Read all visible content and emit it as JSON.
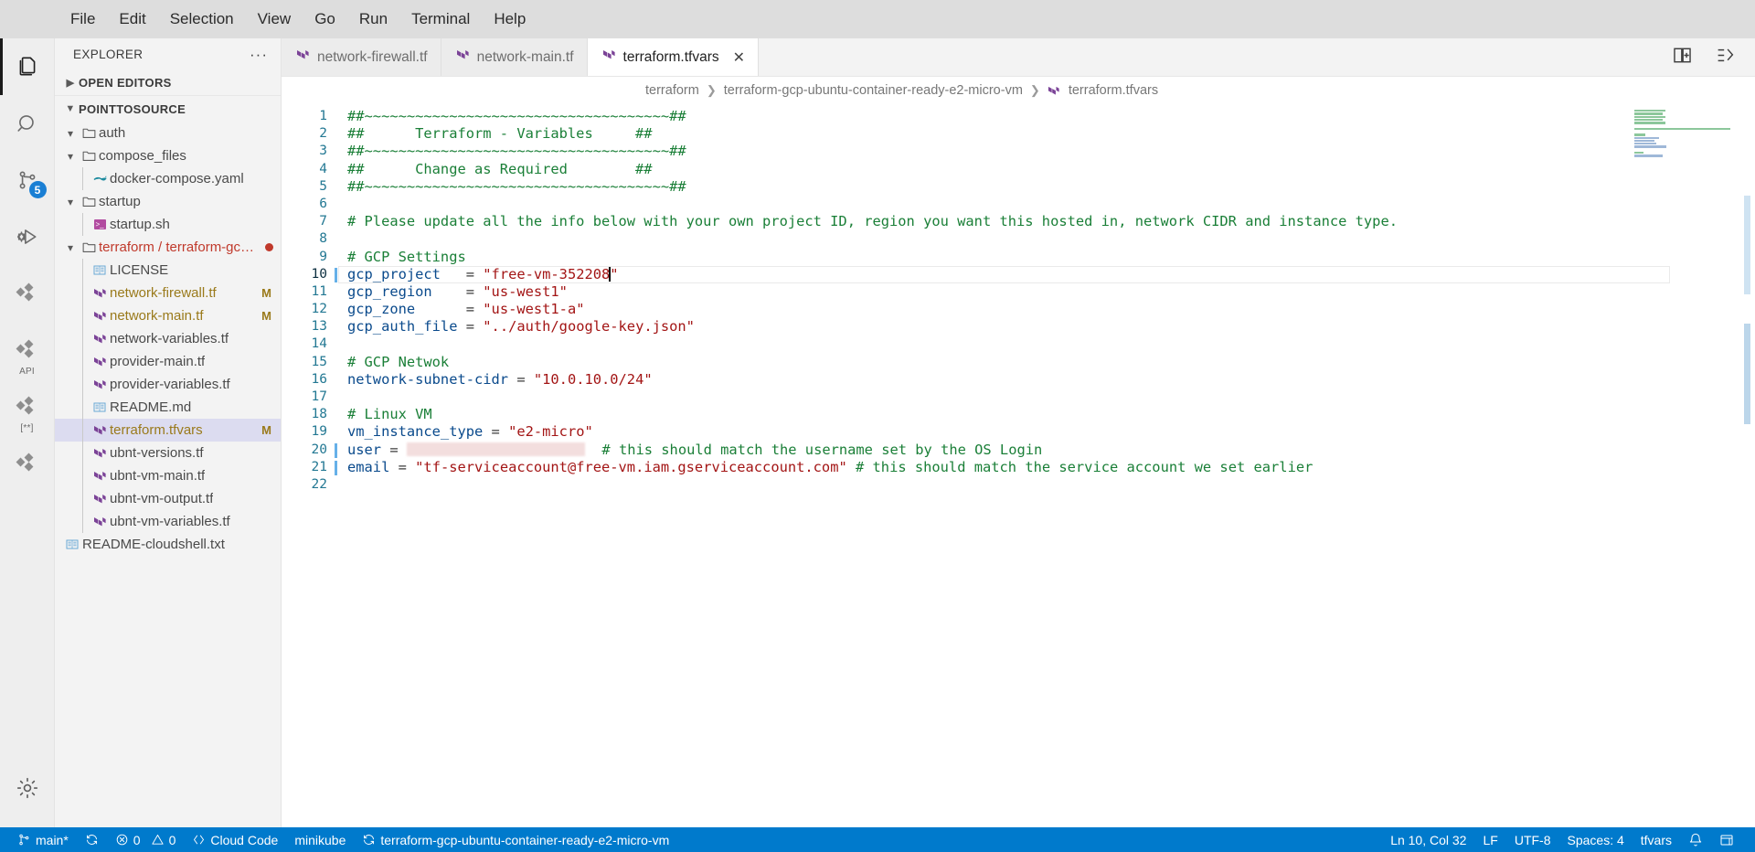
{
  "menubar": {
    "items": [
      "File",
      "Edit",
      "Selection",
      "View",
      "Go",
      "Run",
      "Terminal",
      "Help"
    ]
  },
  "activitybar": {
    "items": [
      {
        "name": "explorer-icon",
        "glyph": "files",
        "active": true,
        "badge": null,
        "sub": null
      },
      {
        "name": "search-icon",
        "glyph": "search",
        "active": false,
        "badge": null,
        "sub": null
      },
      {
        "name": "source-control-icon",
        "glyph": "source-control",
        "active": false,
        "badge": "5",
        "sub": null
      },
      {
        "name": "run-and-debug-icon",
        "glyph": "debug",
        "active": false,
        "badge": null,
        "sub": null
      },
      {
        "name": "extensions-icon",
        "glyph": "extensions",
        "active": false,
        "badge": null,
        "sub": null
      },
      {
        "name": "api-extension-icon",
        "glyph": "extensions",
        "active": false,
        "badge": null,
        "sub": "API"
      },
      {
        "name": "secrets-extension-icon",
        "glyph": "extensions",
        "active": false,
        "badge": null,
        "sub": "[**]"
      },
      {
        "name": "kubernetes-extension-icon",
        "glyph": "extensions",
        "active": false,
        "badge": null,
        "sub": null
      }
    ],
    "settings_label": "manage-gear"
  },
  "sidebar": {
    "title": "EXPLORER",
    "more_actions": "···",
    "open_editors_label": "OPEN EDITORS",
    "workspace_label": "POINTTOSOURCE",
    "tree": [
      {
        "label": "auth",
        "kind": "folder",
        "depth": 1,
        "expanded": true,
        "color": "plain",
        "modified": "",
        "selected": false,
        "dirty": false
      },
      {
        "label": "compose_files",
        "kind": "folder",
        "depth": 1,
        "expanded": true,
        "color": "plain",
        "modified": "",
        "selected": false,
        "dirty": false
      },
      {
        "label": "docker-compose.yaml",
        "kind": "yaml",
        "depth": 2,
        "expanded": null,
        "color": "plain",
        "modified": "",
        "selected": false,
        "dirty": false
      },
      {
        "label": "startup",
        "kind": "folder",
        "depth": 1,
        "expanded": true,
        "color": "plain",
        "modified": "",
        "selected": false,
        "dirty": false
      },
      {
        "label": "startup.sh",
        "kind": "shell",
        "depth": 2,
        "expanded": null,
        "color": "plain",
        "modified": "",
        "selected": false,
        "dirty": false
      },
      {
        "label": "terraform / terraform-gcp-ubuntu",
        "kind": "folder",
        "depth": 1,
        "expanded": true,
        "color": "red",
        "modified": "",
        "selected": false,
        "dirty": true
      },
      {
        "label": "LICENSE",
        "kind": "doc",
        "depth": 2,
        "expanded": null,
        "color": "plain",
        "modified": "",
        "selected": false,
        "dirty": false
      },
      {
        "label": "network-firewall.tf",
        "kind": "terraform",
        "depth": 2,
        "expanded": null,
        "color": "tf",
        "modified": "M",
        "selected": false,
        "dirty": false
      },
      {
        "label": "network-main.tf",
        "kind": "terraform",
        "depth": 2,
        "expanded": null,
        "color": "tf",
        "modified": "M",
        "selected": false,
        "dirty": false
      },
      {
        "label": "network-variables.tf",
        "kind": "terraform",
        "depth": 2,
        "expanded": null,
        "color": "plain",
        "modified": "",
        "selected": false,
        "dirty": false
      },
      {
        "label": "provider-main.tf",
        "kind": "terraform",
        "depth": 2,
        "expanded": null,
        "color": "plain",
        "modified": "",
        "selected": false,
        "dirty": false
      },
      {
        "label": "provider-variables.tf",
        "kind": "terraform",
        "depth": 2,
        "expanded": null,
        "color": "plain",
        "modified": "",
        "selected": false,
        "dirty": false
      },
      {
        "label": "README.md",
        "kind": "doc",
        "depth": 2,
        "expanded": null,
        "color": "plain",
        "modified": "",
        "selected": false,
        "dirty": false
      },
      {
        "label": "terraform.tfvars",
        "kind": "terraform",
        "depth": 2,
        "expanded": null,
        "color": "tf",
        "modified": "M",
        "selected": true,
        "dirty": false
      },
      {
        "label": "ubnt-versions.tf",
        "kind": "terraform",
        "depth": 2,
        "expanded": null,
        "color": "plain",
        "modified": "",
        "selected": false,
        "dirty": false
      },
      {
        "label": "ubnt-vm-main.tf",
        "kind": "terraform",
        "depth": 2,
        "expanded": null,
        "color": "plain",
        "modified": "",
        "selected": false,
        "dirty": false
      },
      {
        "label": "ubnt-vm-output.tf",
        "kind": "terraform",
        "depth": 2,
        "expanded": null,
        "color": "plain",
        "modified": "",
        "selected": false,
        "dirty": false
      },
      {
        "label": "ubnt-vm-variables.tf",
        "kind": "terraform",
        "depth": 2,
        "expanded": null,
        "color": "plain",
        "modified": "",
        "selected": false,
        "dirty": false
      },
      {
        "label": "README-cloudshell.txt",
        "kind": "doc",
        "depth": 1,
        "expanded": null,
        "color": "plain",
        "modified": "",
        "selected": false,
        "dirty": false
      }
    ]
  },
  "tabs": [
    {
      "label": "network-firewall.tf",
      "active": false,
      "closable": false
    },
    {
      "label": "network-main.tf",
      "active": false,
      "closable": false
    },
    {
      "label": "terraform.tfvars",
      "active": true,
      "closable": true
    }
  ],
  "tab_actions": [
    {
      "name": "split-editor-icon",
      "glyph": "split"
    },
    {
      "name": "more-actions-icon",
      "glyph": "layout"
    }
  ],
  "breadcrumbs": [
    "terraform",
    "terraform-gcp-ubuntu-container-ready-e2-micro-vm",
    "terraform.tfvars"
  ],
  "editor": {
    "filename": "terraform.tfvars",
    "lines": [
      {
        "n": 1,
        "tokens": [
          {
            "t": "##~~~~~~~~~~~~~~~~~~~~~~~~~~~~~~~~~~~~##",
            "c": "cmt"
          }
        ]
      },
      {
        "n": 2,
        "tokens": [
          {
            "t": "##      Terraform - Variables     ##",
            "c": "cmt"
          }
        ]
      },
      {
        "n": 3,
        "tokens": [
          {
            "t": "##~~~~~~~~~~~~~~~~~~~~~~~~~~~~~~~~~~~~##",
            "c": "cmt"
          }
        ]
      },
      {
        "n": 4,
        "tokens": [
          {
            "t": "##      Change as Required        ##",
            "c": "cmt"
          }
        ]
      },
      {
        "n": 5,
        "tokens": [
          {
            "t": "##~~~~~~~~~~~~~~~~~~~~~~~~~~~~~~~~~~~~##",
            "c": "cmt"
          }
        ]
      },
      {
        "n": 6,
        "tokens": []
      },
      {
        "n": 7,
        "tokens": [
          {
            "t": "# Please update all the info below with your own project ID, region you want this hosted in, network CIDR and instance type.",
            "c": "cmt"
          }
        ]
      },
      {
        "n": 8,
        "tokens": []
      },
      {
        "n": 9,
        "tokens": [
          {
            "t": "# GCP Settings",
            "c": "cmt"
          }
        ]
      },
      {
        "n": 10,
        "current": true,
        "tokens": [
          {
            "t": "gcp_project",
            "c": "var"
          },
          {
            "t": "   = ",
            "c": "op"
          },
          {
            "t": "\"free-vm-352208",
            "c": "str"
          },
          {
            "t": "CARET",
            "c": "caret"
          },
          {
            "t": "\"",
            "c": "str"
          }
        ]
      },
      {
        "n": 11,
        "tokens": [
          {
            "t": "gcp_region",
            "c": "var"
          },
          {
            "t": "    = ",
            "c": "op"
          },
          {
            "t": "\"us-west1\"",
            "c": "str"
          }
        ]
      },
      {
        "n": 12,
        "tokens": [
          {
            "t": "gcp_zone",
            "c": "var"
          },
          {
            "t": "      = ",
            "c": "op"
          },
          {
            "t": "\"us-west1-a\"",
            "c": "str"
          }
        ]
      },
      {
        "n": 13,
        "tokens": [
          {
            "t": "gcp_auth_file",
            "c": "var"
          },
          {
            "t": " = ",
            "c": "op"
          },
          {
            "t": "\"../auth/google-key.json\"",
            "c": "str"
          }
        ]
      },
      {
        "n": 14,
        "tokens": []
      },
      {
        "n": 15,
        "tokens": [
          {
            "t": "# GCP Netwok",
            "c": "cmt"
          }
        ]
      },
      {
        "n": 16,
        "tokens": [
          {
            "t": "network-subnet-cidr",
            "c": "var"
          },
          {
            "t": " = ",
            "c": "op"
          },
          {
            "t": "\"10.0.10.0/24\"",
            "c": "str"
          }
        ]
      },
      {
        "n": 17,
        "tokens": []
      },
      {
        "n": 18,
        "tokens": [
          {
            "t": "# Linux VM",
            "c": "cmt"
          }
        ]
      },
      {
        "n": 19,
        "tokens": [
          {
            "t": "vm_instance_type",
            "c": "var"
          },
          {
            "t": " = ",
            "c": "op"
          },
          {
            "t": "\"e2-micro\"",
            "c": "str"
          }
        ]
      },
      {
        "n": 20,
        "modified": true,
        "tokens": [
          {
            "t": "user",
            "c": "var"
          },
          {
            "t": " = ",
            "c": "op"
          },
          {
            "t": "REDACTED",
            "c": "redacted"
          },
          {
            "t": "  # this should match the username set by the OS Login",
            "c": "cmt"
          }
        ]
      },
      {
        "n": 21,
        "modified": true,
        "tokens": [
          {
            "t": "email",
            "c": "var"
          },
          {
            "t": " = ",
            "c": "op"
          },
          {
            "t": "\"tf-serviceaccount@free-vm.iam.gserviceaccount.com\"",
            "c": "str"
          },
          {
            "t": " # this should match the service account we set earlier",
            "c": "cmt"
          }
        ]
      },
      {
        "n": 22,
        "tokens": []
      }
    ]
  },
  "statusbar": {
    "left": [
      {
        "name": "branch-status",
        "icon": "source-control",
        "label": "main*"
      },
      {
        "name": "sync-status",
        "icon": "sync",
        "label": ""
      },
      {
        "name": "problems-status",
        "icon": "error-warning",
        "label": "0  0",
        "errors": "0",
        "warnings": "0"
      },
      {
        "name": "cloud-code-status",
        "icon": "code-brackets",
        "label": "Cloud Code"
      },
      {
        "name": "minikube-status",
        "icon": "",
        "label": "minikube"
      },
      {
        "name": "workspace-sync-status",
        "icon": "sync",
        "label": "terraform-gcp-ubuntu-container-ready-e2-micro-vm"
      }
    ],
    "right": [
      {
        "name": "cursor-position-status",
        "label": "Ln 10, Col 32"
      },
      {
        "name": "line-ending-status",
        "label": "LF"
      },
      {
        "name": "encoding-status",
        "label": "UTF-8"
      },
      {
        "name": "indentation-status",
        "label": "Spaces: 4"
      },
      {
        "name": "language-mode-status",
        "label": "tfvars"
      },
      {
        "name": "notifications-status",
        "icon": "bell",
        "label": ""
      },
      {
        "name": "panel-layout-status",
        "icon": "layout",
        "label": ""
      }
    ]
  },
  "colors": {
    "accent": "#007acc",
    "comment": "#1a7f37",
    "string": "#a31515",
    "variable": "#0a4a8c",
    "selection": "#dcdcf0",
    "modified": "#9a7a1b"
  }
}
